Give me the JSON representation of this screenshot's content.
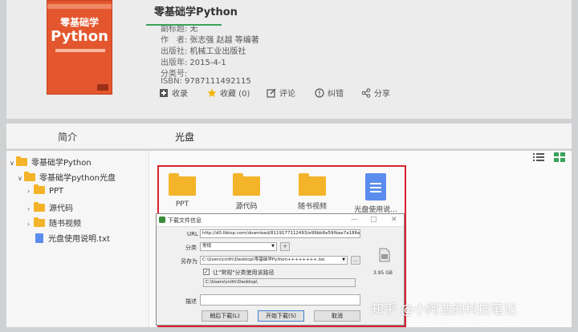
{
  "book": {
    "title": "零基础学Python",
    "cover_text": "零基础学",
    "cover_big": "Python",
    "meta": [
      {
        "label": "副标题:",
        "value": "无"
      },
      {
        "label": "作　者:",
        "value": "张志强 赵越 等编著"
      },
      {
        "label": "出版社:",
        "value": "机械工业出版社"
      },
      {
        "label": "出版年:",
        "value": "2015-4-1"
      },
      {
        "label": "分类号:",
        "value": ""
      },
      {
        "label": "ISBN:",
        "value": "9787111492115"
      }
    ]
  },
  "actions": {
    "save": "收录",
    "favorite": "收藏 (0)",
    "comment": "评论",
    "errata": "纠错",
    "share": "分享"
  },
  "tabs": {
    "intro": "简介",
    "disc": "光盘"
  },
  "tree": {
    "root": "零基础学Python",
    "disc_folder": "零基础学python光盘",
    "children": [
      "PPT",
      "源代码",
      "随书视频"
    ],
    "file": "光盘使用说明.txt"
  },
  "grid": {
    "items": [
      "PPT",
      "源代码",
      "随书视频",
      "光盘使用说..."
    ]
  },
  "dialog": {
    "title": "下载文件信息",
    "url_label": "URL",
    "url_value": "http://d0.libtop.com/download/8119177112493/e99bb6e59fbae7a186e5a",
    "category_label": "分类",
    "category_value": "常规",
    "plus": "+",
    "saveas_label": "另存为",
    "saveas_value": "C:\\Users\\cnith\\Desktop\\零基础学Python++++++++.iso",
    "browse": "...",
    "checkbox_label": "让\"常规\"分类使用该路径",
    "path_value": "C:\\Users\\cnith\\Desktop\\",
    "desc_label": "描述",
    "size": "3.95 GB",
    "btn_later": "稍后下载(L)",
    "btn_start": "开始下载(S)",
    "btn_cancel": "取消"
  },
  "watermark": "知乎 @小阿浩的科技笔记",
  "colors": {
    "accent_green": "#3aa35b",
    "highlight_red": "#d9232e",
    "folder_yellow": "#f3b429",
    "doc_blue": "#5b8def"
  }
}
